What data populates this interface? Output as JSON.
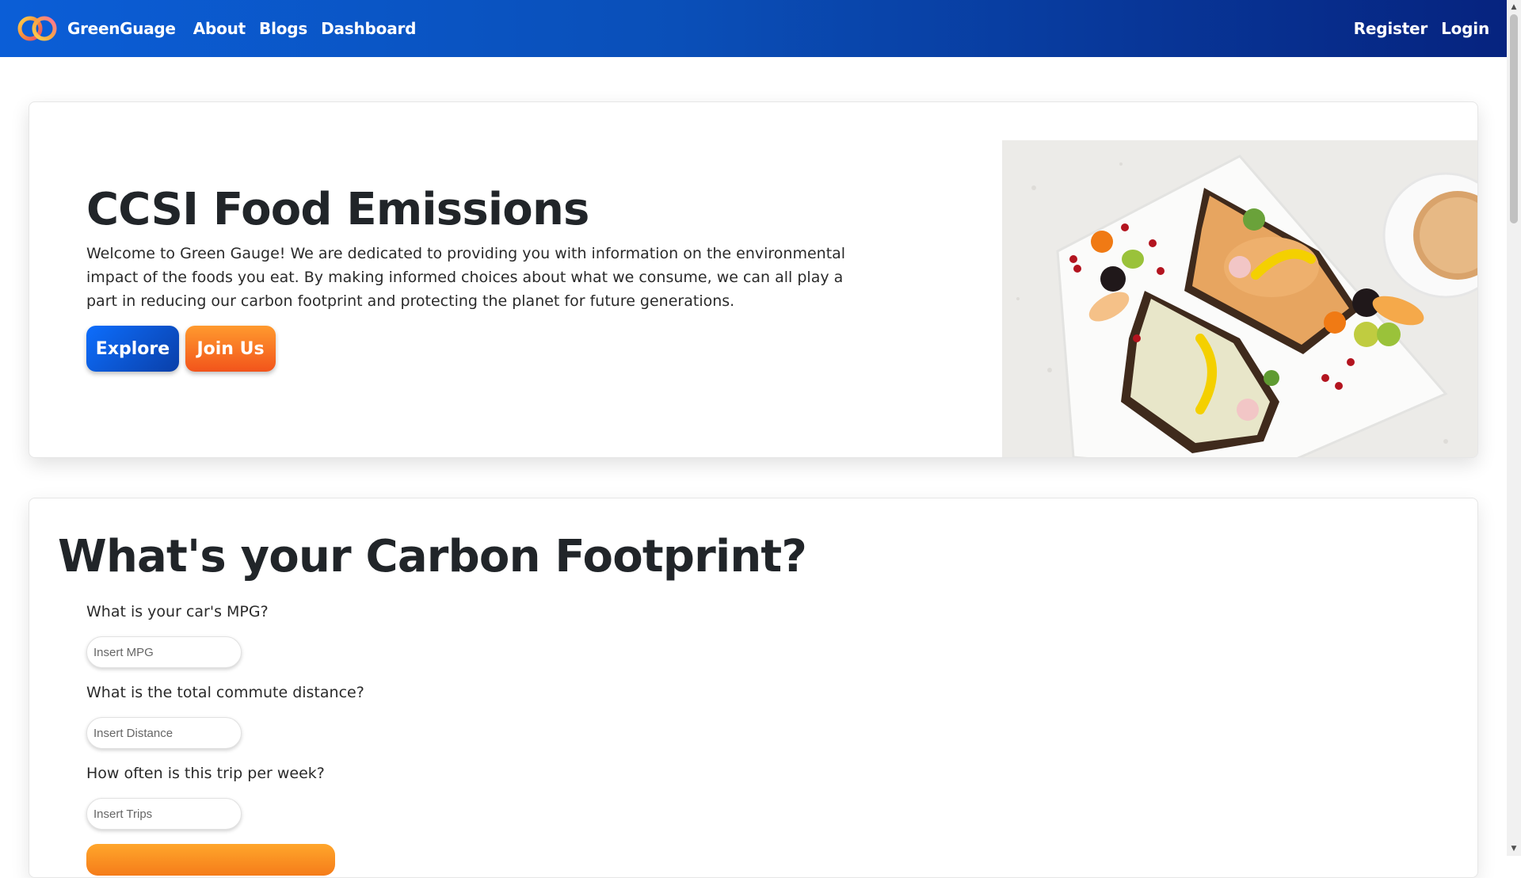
{
  "nav": {
    "brand": "GreenGuage",
    "links": [
      "About",
      "Blogs",
      "Dashboard"
    ],
    "right_links": [
      "Register",
      "Login"
    ]
  },
  "hero": {
    "title": "CCSI Food Emissions",
    "text": "Welcome to Green Gauge! We are dedicated to providing you with information on the environmental impact of the foods you eat. By making informed choices about what we consume, we can all play a part in reducing our carbon footprint and protecting the planet for future generations.",
    "explore_label": "Explore",
    "join_label": "Join Us"
  },
  "carbon": {
    "title": "What's your Carbon Footprint?",
    "questions": [
      {
        "label": "What is your car's MPG?",
        "placeholder": "Insert MPG"
      },
      {
        "label": "What is the total commute distance?",
        "placeholder": "Insert Distance"
      },
      {
        "label": "How often is this trip per week?",
        "placeholder": "Insert Trips"
      }
    ]
  },
  "colors": {
    "nav_start": "#0b5ed7",
    "nav_end": "#06237f",
    "explore": "#0a4fc4",
    "join": "#f5661f",
    "calculate": "#f98e1f"
  }
}
